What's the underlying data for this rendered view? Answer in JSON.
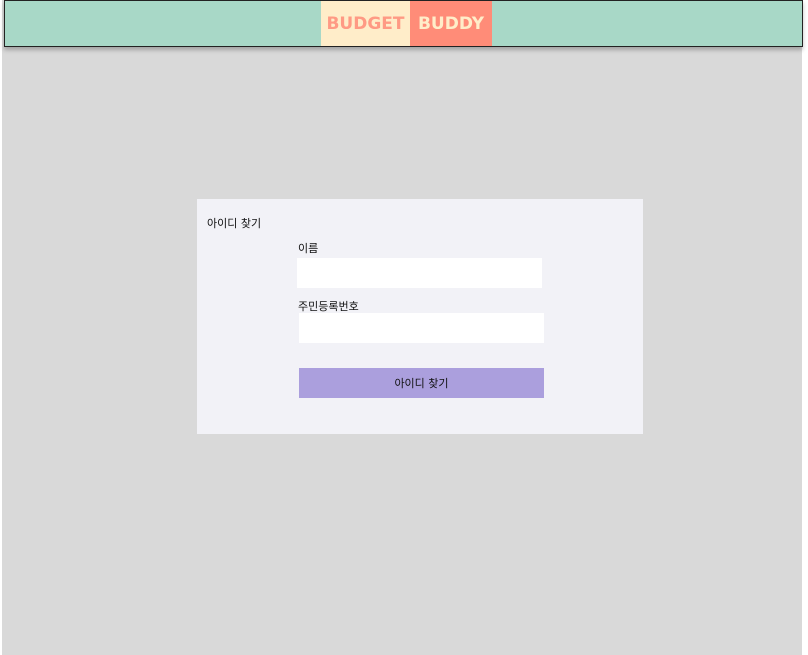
{
  "header": {
    "logo_part1": "BUDGET",
    "logo_part2": "BUDDY"
  },
  "find_id_form": {
    "title": "아이디 찾기",
    "name_label": "이름",
    "name_value": "",
    "rrn_label": "주민등록번호",
    "rrn_value": "",
    "submit_label": "아이디 찾기"
  },
  "colors": {
    "header_bg": "#a8d8c7",
    "logo_light": "#ffedc9",
    "logo_salmon": "#ff8c78",
    "page_bg": "#d9d9d9",
    "card_bg": "#f2f2f7",
    "button_bg": "#ab9fdd"
  }
}
